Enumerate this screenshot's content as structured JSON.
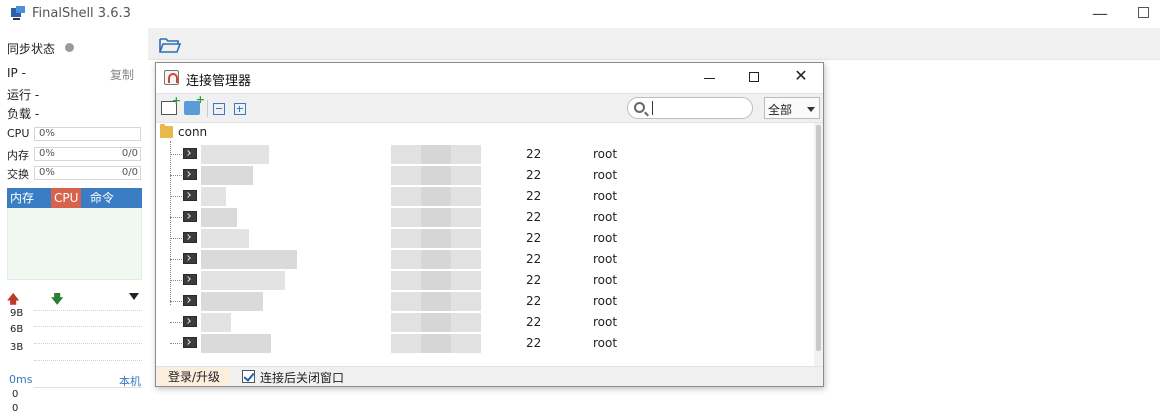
{
  "app": {
    "title": "FinalShell 3.6.3"
  },
  "sidebar": {
    "sync_label": "同步状态",
    "ip_label": "IP  -",
    "copy_label": "复制",
    "uptime_label": "运行 -",
    "load_label": "负载 -",
    "cpu": {
      "label": "CPU",
      "percent": "0%",
      "ratio": ""
    },
    "memory": {
      "label": "内存",
      "percent": "0%",
      "ratio": "0/0"
    },
    "swap": {
      "label": "交换",
      "percent": "0%",
      "ratio": "0/0"
    },
    "process_tabs": [
      {
        "label": "内存",
        "active": false
      },
      {
        "label": "CPU",
        "active": true
      },
      {
        "label": "命令",
        "active": false
      }
    ],
    "net_scale": [
      "9B",
      "6B",
      "3B"
    ],
    "ping_label": "0ms",
    "ping_host": "本机",
    "ping_scale": [
      "0",
      "0"
    ]
  },
  "dialog": {
    "title": "连接管理器",
    "search": {
      "value": "",
      "placeholder": ""
    },
    "filter": "全部",
    "folder_name": "conn",
    "connections": [
      {
        "port": "22",
        "user": "root"
      },
      {
        "port": "22",
        "user": "root"
      },
      {
        "port": "22",
        "user": "root"
      },
      {
        "port": "22",
        "user": "root"
      },
      {
        "port": "22",
        "user": "root"
      },
      {
        "port": "22",
        "user": "root"
      },
      {
        "port": "22",
        "user": "root"
      },
      {
        "port": "22",
        "user": "root"
      },
      {
        "port": "22",
        "user": "root"
      },
      {
        "port": "22",
        "user": "root"
      }
    ],
    "login_button": "登录/升级",
    "close_after_connect": {
      "label": "连接后关闭窗口",
      "checked": true
    }
  },
  "colors": {
    "accent_blue": "#3a7dc4",
    "active_tab_red": "#d9624d",
    "folder_yellow": "#e8b84a"
  }
}
